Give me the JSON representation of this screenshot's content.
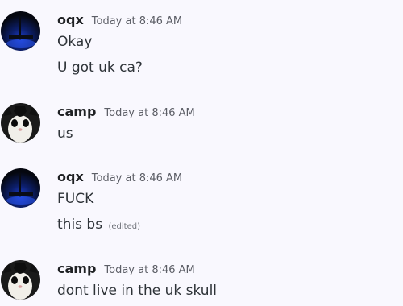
{
  "messages": [
    {
      "username": "oqx",
      "timestamp": "Today at 8:46 AM",
      "avatar": "dark-blue-night-avatar",
      "lines": [
        "Okay",
        "U got uk ca?"
      ]
    },
    {
      "username": "camp",
      "timestamp": "Today at 8:46 AM",
      "avatar": "cat-face-avatar",
      "lines": [
        "us"
      ]
    },
    {
      "username": "oqx",
      "timestamp": "Today at 8:46 AM",
      "avatar": "dark-blue-night-avatar",
      "lines": [
        "FUCK",
        "this bs"
      ],
      "edited_label": "(edited)"
    },
    {
      "username": "camp",
      "timestamp": "Today at 8:46 AM",
      "avatar": "cat-face-avatar",
      "lines": [
        "dont live in the uk skull"
      ]
    }
  ],
  "colors": {
    "background": "#f9f8fe",
    "username": "#1f2124",
    "text": "#2e3338",
    "timestamp": "#5c5e66"
  }
}
